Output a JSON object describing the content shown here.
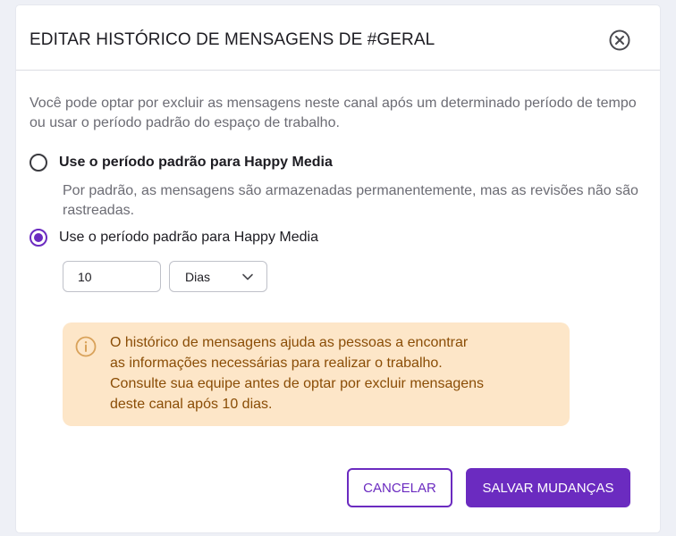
{
  "modal": {
    "title": "EDITAR HISTÓRICO DE MENSAGENS DE #GERAL",
    "close_icon": "close-circle-icon",
    "description": "Você pode optar por excluir as mensagens neste canal após um determinado período de tempo ou usar o período padrão do espaço de trabalho."
  },
  "options": [
    {
      "label": "Use o período padrão para Happy Media",
      "selected": false,
      "subtext": "Por padrão, as mensagens são armazenadas permanentemente, mas as revisões não são rastreadas."
    },
    {
      "label": "Use o período padrão para Happy Media",
      "selected": true
    }
  ],
  "retention": {
    "value": "10",
    "unit": "Dias",
    "dropdown_icon": "chevron-down-icon"
  },
  "alert": {
    "icon": "info-icon",
    "text_lines": [
      "O histórico de mensagens ajuda as pessoas a encontrar",
      "as informações necessárias para realizar o trabalho.",
      "Consulte sua equipe antes de optar por excluir mensagens",
      "deste canal após 10 dias."
    ]
  },
  "footer": {
    "cancel_label": "CANCELAR",
    "save_label": "SALVAR MUDANÇAS"
  },
  "colors": {
    "accent": "#6b2bc0",
    "alert_bg": "#fde6c8",
    "alert_text": "#8a4d06"
  }
}
